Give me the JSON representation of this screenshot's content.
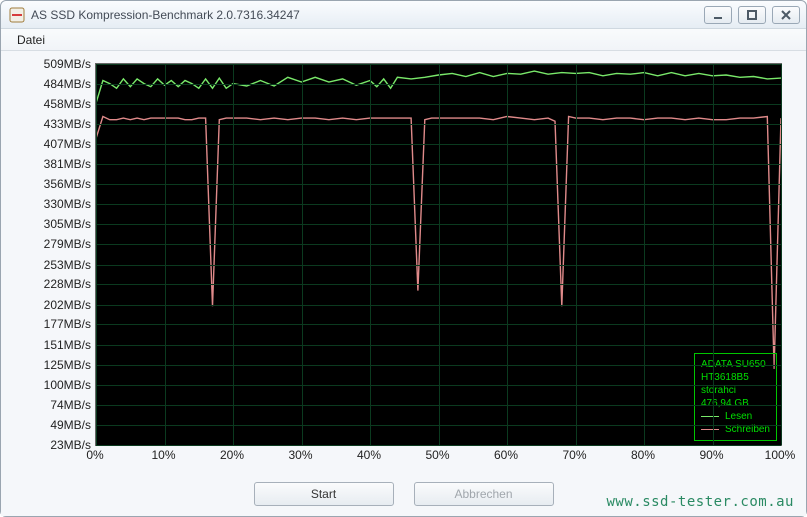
{
  "window": {
    "title": "AS SSD Kompression-Benchmark 2.0.7316.34247",
    "menu": {
      "datei": "Datei"
    }
  },
  "buttons": {
    "start": "Start",
    "abort": "Abbrechen"
  },
  "watermark": "www.ssd-tester.com.au",
  "chart_data": {
    "type": "line",
    "xlabel": "",
    "ylabel": "",
    "x_ticks": [
      "0%",
      "10%",
      "20%",
      "30%",
      "40%",
      "50%",
      "60%",
      "70%",
      "80%",
      "90%",
      "100%"
    ],
    "y_ticks": [
      23,
      49,
      74,
      100,
      125,
      151,
      177,
      202,
      228,
      253,
      279,
      305,
      330,
      356,
      381,
      407,
      433,
      458,
      484,
      509
    ],
    "y_unit": "MB/s",
    "x_range": [
      0,
      100
    ],
    "y_range": [
      23,
      509
    ],
    "series": [
      {
        "name": "Lesen",
        "color": "#79e86a",
        "x": [
          0,
          1,
          2,
          3,
          4,
          5,
          6,
          7,
          8,
          9,
          10,
          11,
          12,
          13,
          14,
          15,
          16,
          17,
          18,
          19,
          20,
          22,
          24,
          26,
          28,
          30,
          32,
          34,
          36,
          38,
          40,
          41,
          42,
          43,
          44,
          46,
          48,
          50,
          52,
          54,
          56,
          58,
          60,
          62,
          64,
          66,
          68,
          70,
          72,
          74,
          76,
          78,
          80,
          82,
          84,
          86,
          88,
          90,
          92,
          94,
          96,
          98,
          100
        ],
        "y": [
          459,
          488,
          484,
          478,
          490,
          480,
          490,
          484,
          480,
          490,
          482,
          488,
          480,
          488,
          484,
          478,
          490,
          478,
          491,
          478,
          484,
          481,
          488,
          481,
          492,
          486,
          492,
          486,
          490,
          482,
          488,
          480,
          490,
          478,
          492,
          490,
          492,
          495,
          497,
          493,
          498,
          493,
          497,
          496,
          500,
          496,
          498,
          497,
          498,
          494,
          497,
          496,
          498,
          494,
          498,
          494,
          497,
          494,
          495,
          492,
          493,
          490,
          491
        ]
      },
      {
        "name": "Schreiben",
        "color": "#e08a8a",
        "x": [
          0,
          1,
          2,
          3,
          4,
          5,
          6,
          7,
          8,
          9,
          10,
          11,
          12,
          13,
          14,
          15,
          16,
          17,
          18,
          19,
          20,
          22,
          24,
          26,
          28,
          30,
          32,
          34,
          36,
          38,
          40,
          42,
          44,
          46,
          47,
          48,
          49,
          50,
          52,
          54,
          56,
          58,
          60,
          62,
          64,
          66,
          67,
          68,
          69,
          70,
          72,
          74,
          76,
          78,
          80,
          82,
          84,
          86,
          88,
          90,
          92,
          94,
          96,
          98,
          99,
          100
        ],
        "y": [
          414,
          442,
          438,
          438,
          440,
          438,
          440,
          438,
          440,
          440,
          440,
          440,
          440,
          438,
          438,
          440,
          440,
          200,
          438,
          440,
          440,
          440,
          438,
          440,
          438,
          440,
          440,
          438,
          440,
          438,
          440,
          440,
          440,
          440,
          220,
          438,
          440,
          440,
          440,
          440,
          440,
          438,
          442,
          440,
          438,
          440,
          436,
          200,
          442,
          440,
          440,
          438,
          440,
          440,
          438,
          440,
          440,
          438,
          440,
          438,
          438,
          440,
          440,
          442,
          120,
          440
        ]
      }
    ],
    "info_panel": {
      "lines": [
        "ADATA SU650",
        "HT3618B5",
        "storahci",
        "476,94 GB"
      ]
    }
  }
}
